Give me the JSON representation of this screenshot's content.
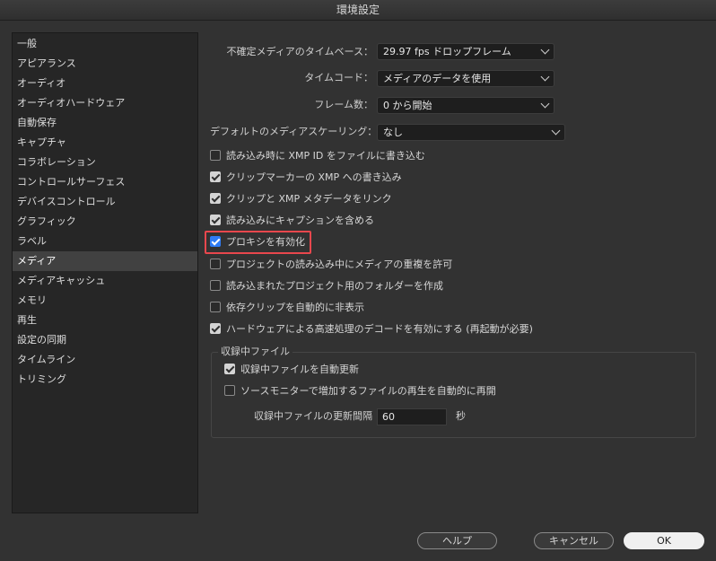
{
  "window": {
    "title": "環境設定"
  },
  "sidebar": {
    "items": [
      {
        "label": "一般"
      },
      {
        "label": "アピアランス"
      },
      {
        "label": "オーディオ"
      },
      {
        "label": "オーディオハードウェア"
      },
      {
        "label": "自動保存"
      },
      {
        "label": "キャプチャ"
      },
      {
        "label": "コラボレーション"
      },
      {
        "label": "コントロールサーフェス"
      },
      {
        "label": "デバイスコントロール"
      },
      {
        "label": "グラフィック"
      },
      {
        "label": "ラベル"
      },
      {
        "label": "メディア"
      },
      {
        "label": "メディアキャッシュ"
      },
      {
        "label": "メモリ"
      },
      {
        "label": "再生"
      },
      {
        "label": "設定の同期"
      },
      {
        "label": "タイムライン"
      },
      {
        "label": "トリミング"
      }
    ],
    "selected": "メディア"
  },
  "settings": {
    "timebase": {
      "label": "不確定メディアのタイムベース：",
      "value": "29.97 fps ドロップフレーム"
    },
    "timecode": {
      "label": "タイムコード：",
      "value": "メディアのデータを使用"
    },
    "frame_count": {
      "label": "フレーム数：",
      "value": "0 から開始"
    },
    "scaling": {
      "label": "デフォルトのメディアスケーリング：",
      "value": "なし"
    }
  },
  "checkboxes": [
    {
      "label": "読み込み時に XMP ID をファイルに書き込む",
      "checked": false
    },
    {
      "label": "クリップマーカーの XMP への書き込み",
      "checked": true
    },
    {
      "label": "クリップと XMP メタデータをリンク",
      "checked": true
    },
    {
      "label": "読み込みにキャプションを含める",
      "checked": true
    },
    {
      "label": "プロキシを有効化",
      "checked": true
    },
    {
      "label": "プロジェクトの読み込み中にメディアの重複を許可",
      "checked": false
    },
    {
      "label": "読み込まれたプロジェクト用のフォルダーを作成",
      "checked": false
    },
    {
      "label": "依存クリップを自動的に非表示",
      "checked": false
    },
    {
      "label": "ハードウェアによる高速処理のデコードを有効にする (再起動が必要)",
      "checked": true
    }
  ],
  "growing_files": {
    "title": "収録中ファイル",
    "auto_refresh": {
      "label": "収録中ファイルを自動更新",
      "checked": true
    },
    "auto_resume": {
      "label": "ソースモニターで増加するファイルの再生を自動的に再開",
      "checked": false
    },
    "interval_label": "収録中ファイルの更新間隔",
    "interval_value": "60",
    "interval_unit": "秒"
  },
  "buttons": {
    "help": "ヘルプ",
    "cancel": "キャンセル",
    "ok": "OK"
  },
  "colors": {
    "accent": "#2f7cf6",
    "highlight": "#e8474d",
    "background": "#323232"
  }
}
